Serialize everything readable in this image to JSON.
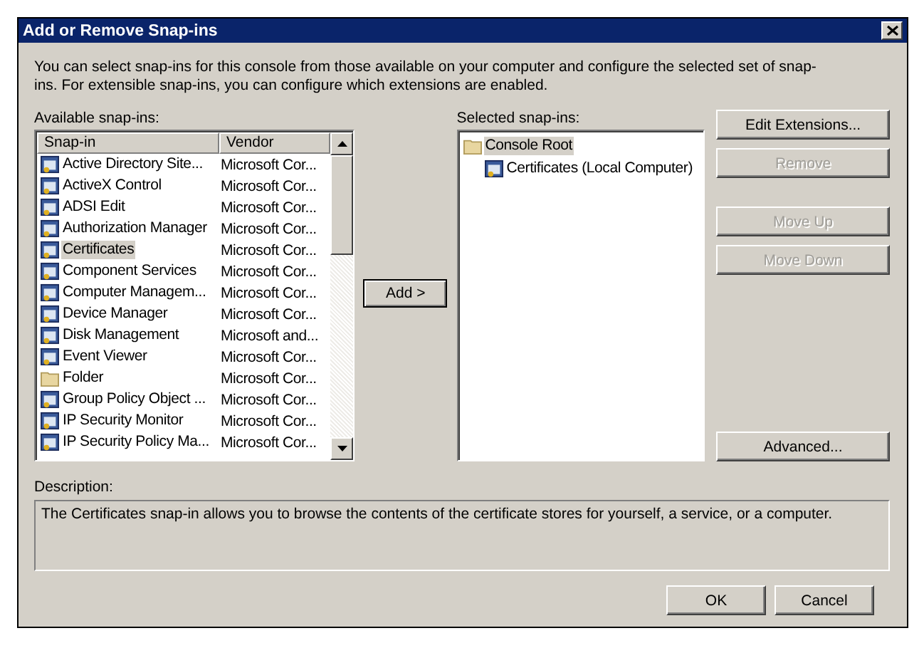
{
  "window": {
    "title": "Add or Remove Snap-ins"
  },
  "intro": "You can select snap-ins for this console from those available on your computer and configure the selected set of snap-ins. For extensible snap-ins, you can configure which extensions are enabled.",
  "available": {
    "label": "Available snap-ins:",
    "columns": [
      "Snap-in",
      "Vendor"
    ],
    "rows": [
      {
        "name": "Active Directory Site...",
        "vendor": "Microsoft Cor...",
        "kind": "snapin",
        "selected": false
      },
      {
        "name": "ActiveX Control",
        "vendor": "Microsoft Cor...",
        "kind": "snapin",
        "selected": false
      },
      {
        "name": "ADSI Edit",
        "vendor": "Microsoft Cor...",
        "kind": "snapin",
        "selected": false
      },
      {
        "name": "Authorization Manager",
        "vendor": "Microsoft Cor...",
        "kind": "snapin",
        "selected": false
      },
      {
        "name": "Certificates",
        "vendor": "Microsoft Cor...",
        "kind": "snapin",
        "selected": true
      },
      {
        "name": "Component Services",
        "vendor": "Microsoft Cor...",
        "kind": "snapin",
        "selected": false
      },
      {
        "name": "Computer Managem...",
        "vendor": "Microsoft Cor...",
        "kind": "snapin",
        "selected": false
      },
      {
        "name": "Device Manager",
        "vendor": "Microsoft Cor...",
        "kind": "snapin",
        "selected": false
      },
      {
        "name": "Disk Management",
        "vendor": "Microsoft and...",
        "kind": "snapin",
        "selected": false
      },
      {
        "name": "Event Viewer",
        "vendor": "Microsoft Cor...",
        "kind": "snapin",
        "selected": false
      },
      {
        "name": "Folder",
        "vendor": "Microsoft Cor...",
        "kind": "folder",
        "selected": false
      },
      {
        "name": "Group Policy Object ...",
        "vendor": "Microsoft Cor...",
        "kind": "snapin",
        "selected": false
      },
      {
        "name": "IP Security Monitor",
        "vendor": "Microsoft Cor...",
        "kind": "snapin",
        "selected": false
      },
      {
        "name": "IP Security Policy Ma...",
        "vendor": "Microsoft Cor...",
        "kind": "snapin",
        "selected": false
      }
    ]
  },
  "add_button": "Add >",
  "selected_snapins": {
    "label": "Selected snap-ins:",
    "tree": [
      {
        "label": "Console Root",
        "kind": "folder",
        "selected": true,
        "children": [
          {
            "label": "Certificates (Local Computer)",
            "kind": "snapin",
            "selected": false
          }
        ]
      }
    ]
  },
  "side_buttons": [
    {
      "label": "Edit Extensions...",
      "disabled": false
    },
    {
      "label": "Remove",
      "disabled": true
    },
    {
      "label": "Move Up",
      "disabled": true
    },
    {
      "label": "Move Down",
      "disabled": true
    },
    {
      "label": "Advanced...",
      "disabled": false
    }
  ],
  "description": {
    "label": "Description:",
    "text": "The Certificates snap-in allows you to browse the contents of the certificate stores for yourself, a service, or a computer."
  },
  "footer_buttons": [
    "OK",
    "Cancel"
  ]
}
